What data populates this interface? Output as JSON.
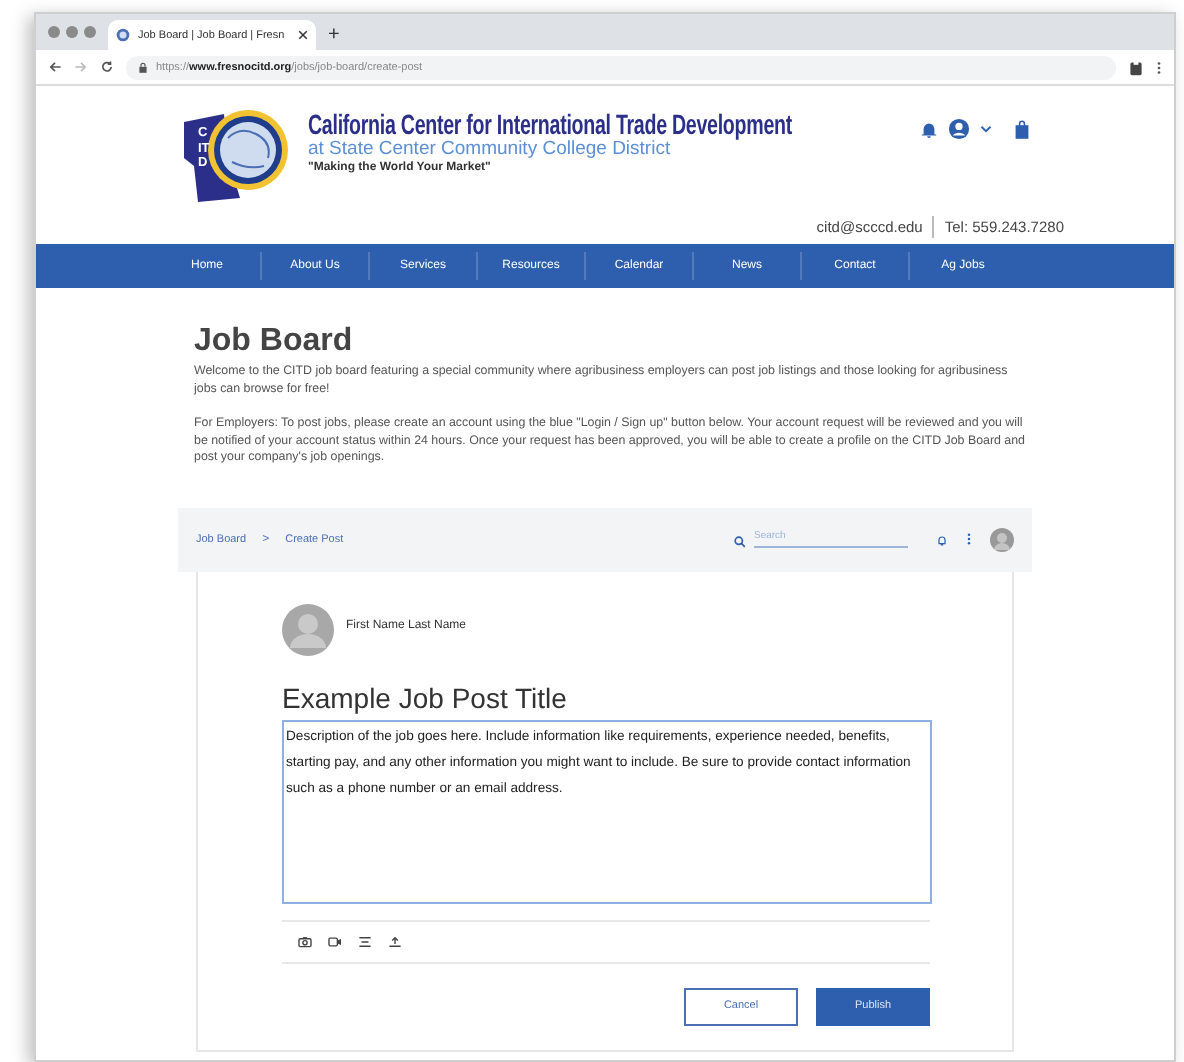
{
  "browser": {
    "tab_title": "Job Board | Job Board | Fresn",
    "new_tab": "+",
    "url": "https://**www.fresnocitd.org**/jobs/job-board/create-post"
  },
  "header": {
    "logo_letters": "CITD",
    "title": "California Center for International Trade Development",
    "subtitle": "at State Center Community College District",
    "tagline": "\"Making the World Your Market\"",
    "email": "citd@scccd.edu",
    "phone": "Tel: 559.243.7280"
  },
  "nav": [
    "Home",
    "About Us",
    "Services",
    "Resources",
    "Calendar",
    "News",
    "Contact",
    "Ag Jobs"
  ],
  "page": {
    "heading": "Job Board",
    "paragraphs": [
      "Welcome to the CITD job board featuring a special community where agribusiness employers can post job listings and those looking for agribusiness jobs can browse for free!",
      "For Employers: To post jobs, please create an account using the blue \"Login / Sign up\" button below. Your account request will be reviewed and you will be notified of your account status within 24 hours. Once your request has been approved, you will be able to create a profile on the CITD Job Board and post your company's job openings."
    ]
  },
  "widget": {
    "breadcrumb": [
      "Job Board",
      "Create Post"
    ],
    "breadcrumb_separator": ">",
    "search": {
      "placeholder": "Search"
    },
    "post": {
      "author": "First Name Last Name",
      "title": "Example Job Post Title",
      "description": "Description of the job goes here. Include information like requirements, experience needed, benefits, starting pay, and any other information you might want to include. Be sure to provide contact information such as a phone number or an email address.",
      "buttons": [
        {
          "label": "Cancel",
          "kind": "secondary"
        },
        {
          "label": "Publish",
          "kind": "primary"
        }
      ]
    }
  }
}
